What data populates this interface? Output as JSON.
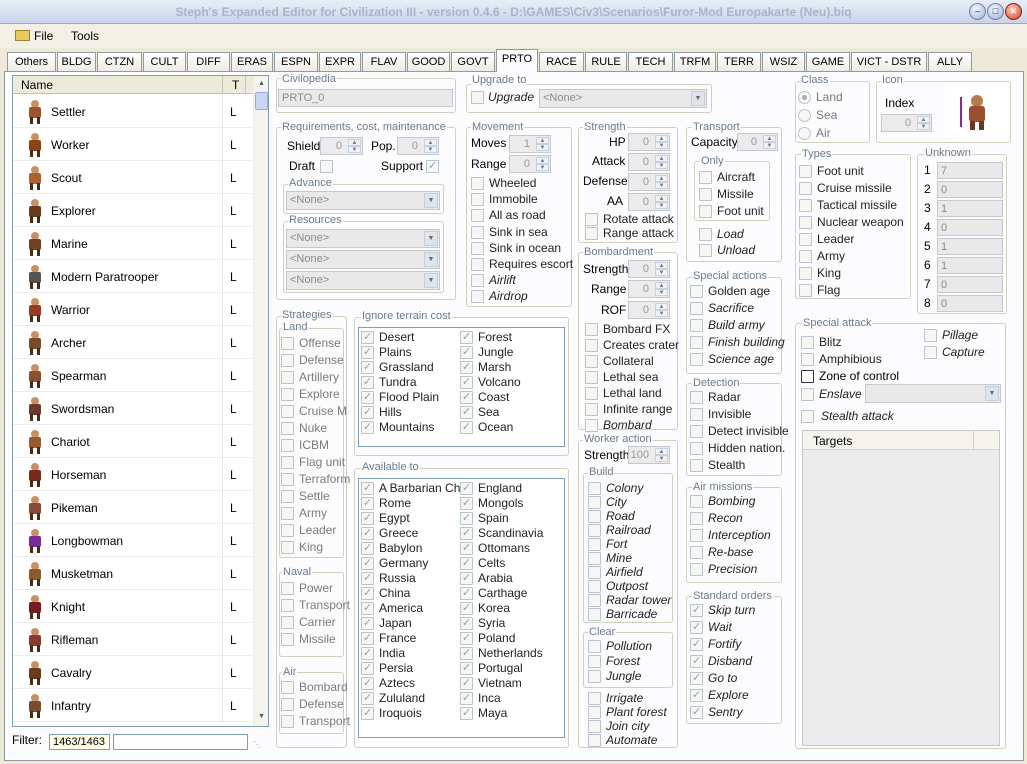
{
  "window": {
    "title": "Steph's Expanded Editor for Civilization III - version 0.4.6 - D:\\GAMES\\Civ3\\Scenarios\\Furor-Mod Europakarte (Neu).biq"
  },
  "menu": {
    "file": "File",
    "tools": "Tools"
  },
  "tabs": [
    "Others",
    "BLDG",
    "CTZN",
    "CULT",
    "DIFF",
    "ERAS",
    "ESPN",
    "EXPR",
    "FLAV",
    "GOOD",
    "GOVT",
    "PRTO",
    "RACE",
    "RULE",
    "TECH",
    "TRFM",
    "TERR",
    "WSIZ",
    "GAME",
    "VICT - DSTR",
    "ALLY"
  ],
  "active_tab": "PRTO",
  "list": {
    "col_name": "Name",
    "col_t": "T",
    "rows": [
      {
        "name": "Settler",
        "t": "L"
      },
      {
        "name": "Worker",
        "t": "L"
      },
      {
        "name": "Scout",
        "t": "L"
      },
      {
        "name": "Explorer",
        "t": "L"
      },
      {
        "name": "Marine",
        "t": "L"
      },
      {
        "name": "Modern Paratrooper",
        "t": "L"
      },
      {
        "name": "Warrior",
        "t": "L"
      },
      {
        "name": "Archer",
        "t": "L"
      },
      {
        "name": "Spearman",
        "t": "L"
      },
      {
        "name": "Swordsman",
        "t": "L"
      },
      {
        "name": "Chariot",
        "t": "L"
      },
      {
        "name": "Horseman",
        "t": "L"
      },
      {
        "name": "Pikeman",
        "t": "L"
      },
      {
        "name": "Longbowman",
        "t": "L"
      },
      {
        "name": "Musketman",
        "t": "L"
      },
      {
        "name": "Knight",
        "t": "L"
      },
      {
        "name": "Rifleman",
        "t": "L"
      },
      {
        "name": "Cavalry",
        "t": "L"
      },
      {
        "name": "Infantry",
        "t": "L"
      }
    ]
  },
  "filter": {
    "label": "Filter:",
    "count": "1463/1463",
    "value": ""
  },
  "civilopedia": {
    "label": "Civilopedia",
    "value": "PRTO_0"
  },
  "upgrade": {
    "label": "Upgrade to",
    "check": "Upgrade",
    "value": "<None>"
  },
  "requirements": {
    "label": "Requirements, cost, maintenance",
    "shield_label": "Shield",
    "shield": "0",
    "pop_label": "Pop.",
    "pop": "0",
    "draft": "Draft",
    "support": "Support",
    "advance_label": "Advance",
    "advance": "<None>",
    "resources_label": "Resources",
    "resources": [
      "<None>",
      "<None>",
      "<None>"
    ]
  },
  "movement": {
    "label": "Movement",
    "moves_label": "Moves",
    "moves": "1",
    "range_label": "Range",
    "range": "0",
    "options": [
      "Wheeled",
      "Immobile",
      "All as road",
      "Sink in sea",
      "Sink in ocean",
      "Requires escort",
      "Airlift",
      "Airdrop"
    ]
  },
  "strength": {
    "label": "Strength",
    "hp_label": "HP",
    "hp": "0",
    "attack_label": "Attack",
    "attack": "0",
    "defense_label": "Defense",
    "defense": "0",
    "aa_label": "AA",
    "aa": "0",
    "options": [
      "Rotate attack",
      "Range attack"
    ]
  },
  "bombardment": {
    "label": "Bombardment",
    "strength_label": "Strength",
    "strength": "0",
    "range_label": "Range",
    "range": "0",
    "rof_label": "ROF",
    "rof": "0",
    "options": [
      "Bombard FX",
      "Creates crater",
      "Collateral",
      "Lethal sea",
      "Lethal land",
      "Infinite range",
      "Bombard"
    ]
  },
  "worker_action": {
    "label": "Worker action",
    "strength_label": "Strength",
    "strength": "100",
    "build_label": "Build",
    "build": [
      "Colony",
      "City",
      "Road",
      "Railroad",
      "Fort",
      "Mine",
      "Airfield",
      "Outpost",
      "Radar tower",
      "Barricade"
    ],
    "clear_label": "Clear",
    "clear": [
      "Pollution",
      "Forest",
      "Jungle"
    ],
    "other": [
      "Irrigate",
      "Plant forest",
      "Join city",
      "Automate"
    ]
  },
  "transport": {
    "label": "Transport",
    "capacity_label": "Capacity",
    "capacity": "0",
    "only_label": "Only",
    "only": [
      "Aircraft",
      "Missile",
      "Foot unit"
    ],
    "load": "Load",
    "unload": "Unload"
  },
  "class": {
    "label": "Class",
    "options": [
      "Land",
      "Sea",
      "Air"
    ],
    "selected": "Land"
  },
  "icon": {
    "label": "Icon",
    "index_label": "Index",
    "index": "0"
  },
  "types": {
    "label": "Types",
    "items": [
      "Foot unit",
      "Cruise missile",
      "Tactical missile",
      "Nuclear weapon",
      "Leader",
      "Army",
      "King",
      "Flag"
    ]
  },
  "unknown": {
    "label": "Unknown",
    "rows": [
      {
        "n": "1",
        "v": "7"
      },
      {
        "n": "2",
        "v": "0"
      },
      {
        "n": "3",
        "v": "1"
      },
      {
        "n": "4",
        "v": "0"
      },
      {
        "n": "5",
        "v": "1"
      },
      {
        "n": "6",
        "v": "1"
      },
      {
        "n": "7",
        "v": "0"
      },
      {
        "n": "8",
        "v": "0"
      }
    ]
  },
  "special_actions": {
    "label": "Special actions",
    "items": [
      "Golden age",
      "Sacrifice",
      "Build army",
      "Finish building",
      "Science age"
    ]
  },
  "detection": {
    "label": "Detection",
    "items": [
      "Radar",
      "Invisible",
      "Detect invisible",
      "Hidden nation.",
      "Stealth"
    ]
  },
  "air_missions": {
    "label": "Air missions",
    "items": [
      "Bombing",
      "Recon",
      "Interception",
      "Re-base",
      "Precision"
    ]
  },
  "standard_orders": {
    "label": "Standard orders",
    "items": [
      "Skip turn",
      "Wait",
      "Fortify",
      "Disband",
      "Go to",
      "Explore",
      "Sentry"
    ]
  },
  "special_attack": {
    "label": "Special attack",
    "blitz": "Blitz",
    "amphibious": "Amphibious",
    "zoc": "Zone of control",
    "enslave": "Enslave",
    "stealth": "Stealth attack",
    "pillage": "Pillage",
    "capture": "Capture",
    "targets": "Targets"
  },
  "strategies": {
    "label": "Strategies",
    "land_label": "Land",
    "land": [
      "Offense",
      "Defense",
      "Artillery",
      "Explore",
      "Cruise M",
      "Nuke",
      "ICBM",
      "Flag unit",
      "Terraform",
      "Settle",
      "Army",
      "Leader",
      "King"
    ],
    "naval_label": "Naval",
    "naval": [
      "Power",
      "Transport",
      "Carrier",
      "Missile"
    ],
    "air_label": "Air",
    "air": [
      "Bombard",
      "Defense",
      "Transport"
    ]
  },
  "ignore_terrain": {
    "label": "Ignore terrain cost",
    "col1": [
      "Desert",
      "Plains",
      "Grassland",
      "Tundra",
      "Flood Plain",
      "Hills",
      "Mountains"
    ],
    "col2": [
      "Forest",
      "Jungle",
      "Marsh",
      "Volcano",
      "Coast",
      "Sea",
      "Ocean"
    ]
  },
  "available_to": {
    "label": "Available to",
    "col1": [
      "A Barbarian Chief",
      "Rome",
      "Egypt",
      "Greece",
      "Babylon",
      "Germany",
      "Russia",
      "China",
      "America",
      "Japan",
      "France",
      "India",
      "Persia",
      "Aztecs",
      "Zululand",
      "Iroquois"
    ],
    "col2": [
      "England",
      "Mongols",
      "Spain",
      "Scandinavia",
      "Ottomans",
      "Celts",
      "Arabia",
      "Carthage",
      "Korea",
      "Syria",
      "Poland",
      "Netherlands",
      "Portugal",
      "Vietnam",
      "Inca",
      "Maya"
    ]
  }
}
